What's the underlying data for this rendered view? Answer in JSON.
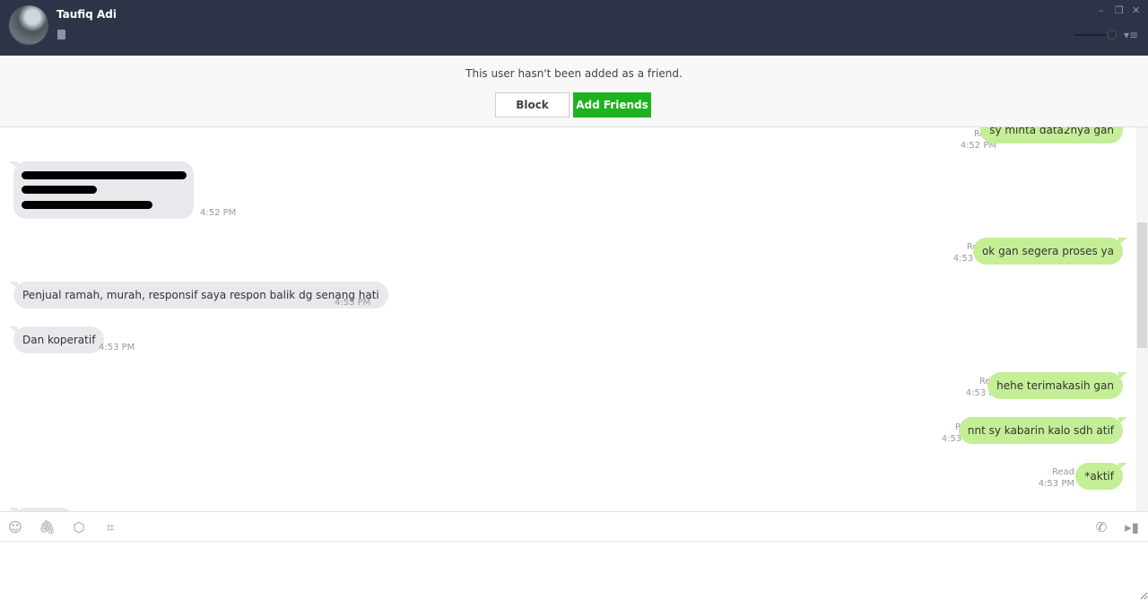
{
  "header": {
    "contact_name": "Taufiq Adi",
    "icons": [
      "avatar",
      "memo-icon",
      "minimize-icon",
      "restore-icon",
      "close-icon",
      "zoom-slider",
      "menu-icon"
    ]
  },
  "notice": {
    "text": "This user hasn't been added as a friend.",
    "block_label": "Block",
    "add_label": "Add Friends"
  },
  "colors": {
    "header": "#2e3447",
    "add_button": "#1fb21f",
    "outgoing_bubble": "#c4ef96",
    "incoming_bubble": "#e7e9ec"
  },
  "messages": [
    {
      "dir": "out",
      "text": "sy minta data2nya gan",
      "status": "Read",
      "time": "4:52 PM"
    },
    {
      "dir": "in",
      "text": "[redacted]",
      "time": "4:52 PM"
    },
    {
      "dir": "out",
      "text": "ok gan segera proses ya",
      "status": "Read",
      "time": "4:53 PM"
    },
    {
      "dir": "in",
      "text": "Penjual ramah, murah, responsif saya respon balik dg senang hati",
      "time": "4:53 PM"
    },
    {
      "dir": "in",
      "text": "Dan koperatif",
      "time": "4:53 PM"
    },
    {
      "dir": "out",
      "text": "hehe terimakasih gan",
      "status": "Read",
      "time": "4:53 PM"
    },
    {
      "dir": "out",
      "text": "nnt sy kabarin kalo sdh atif",
      "status": "Read",
      "time": "4:53 PM"
    },
    {
      "dir": "out",
      "text": "*aktif",
      "status": "Read",
      "time": "4:53 PM"
    }
  ],
  "toolbar": {
    "icons": [
      "emoji-icon",
      "attach-icon",
      "keep-icon",
      "screenshot-icon",
      "call-icon",
      "video-icon"
    ]
  },
  "input": {
    "value": "",
    "placeholder": ""
  }
}
